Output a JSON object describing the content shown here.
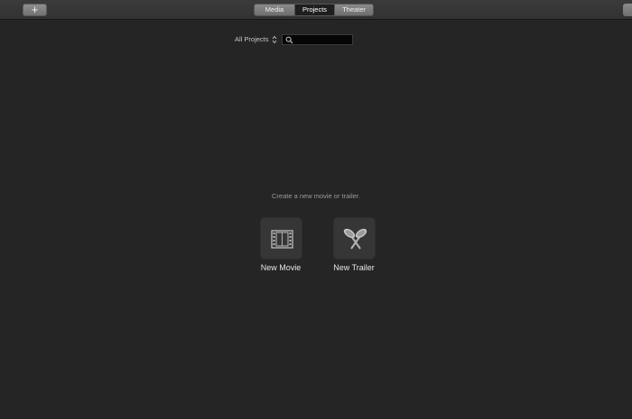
{
  "toolbar": {
    "add_label": "+",
    "segments": [
      {
        "label": "Media",
        "selected": false
      },
      {
        "label": "Projects",
        "selected": true
      },
      {
        "label": "Theater",
        "selected": false
      }
    ]
  },
  "filter": {
    "selected": "All Projects",
    "search_value": ""
  },
  "main": {
    "prompt": "Create a new movie or trailer.",
    "new_movie_label": "New Movie",
    "new_trailer_label": "New Trailer"
  },
  "icons": {
    "add": "plus-icon",
    "updown": "updown-arrows-icon",
    "search": "search-icon",
    "movie": "film-strip-icon",
    "trailer": "spotlights-icon"
  },
  "colors": {
    "background": "#252525",
    "toolbar": "#363636",
    "selected_segment": "#1e1e1e",
    "tile": "#363636"
  }
}
